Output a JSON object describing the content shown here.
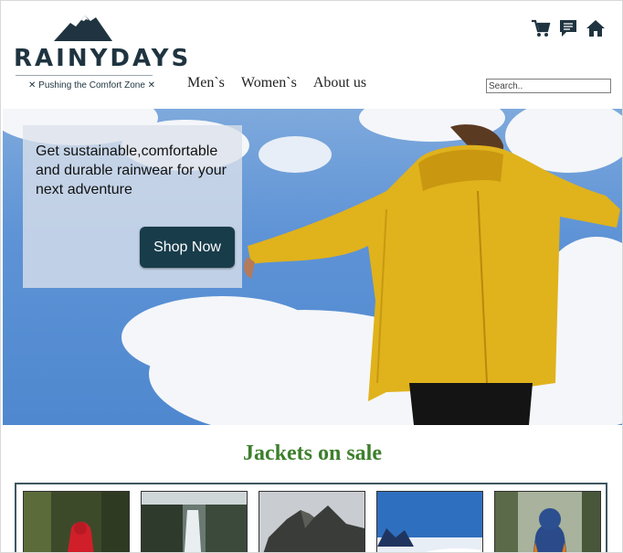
{
  "brand": {
    "name": "RAINYDAYS",
    "tagline": "✕ Pushing the Comfort Zone ✕",
    "colors": {
      "primary": "#1f3440",
      "accent": "#3d7f2c",
      "button": "#183c4a",
      "jacket": "#e0b21c"
    }
  },
  "header_icons": [
    "cart-icon",
    "chat-icon",
    "home-icon"
  ],
  "nav": {
    "items": [
      "Men`s",
      "Women`s",
      "About us"
    ]
  },
  "search": {
    "placeholder": "Search.."
  },
  "hero": {
    "headline": "Get sustainable,comfortable and durable rainwear for your next adventure",
    "cta_label": "Shop Now"
  },
  "sale": {
    "title": "Jackets on sale",
    "products": [
      "red-jacket-forest",
      "waterfall-cliff",
      "rocky-mountain",
      "snowy-mountain",
      "blue-jacket-forest"
    ]
  }
}
